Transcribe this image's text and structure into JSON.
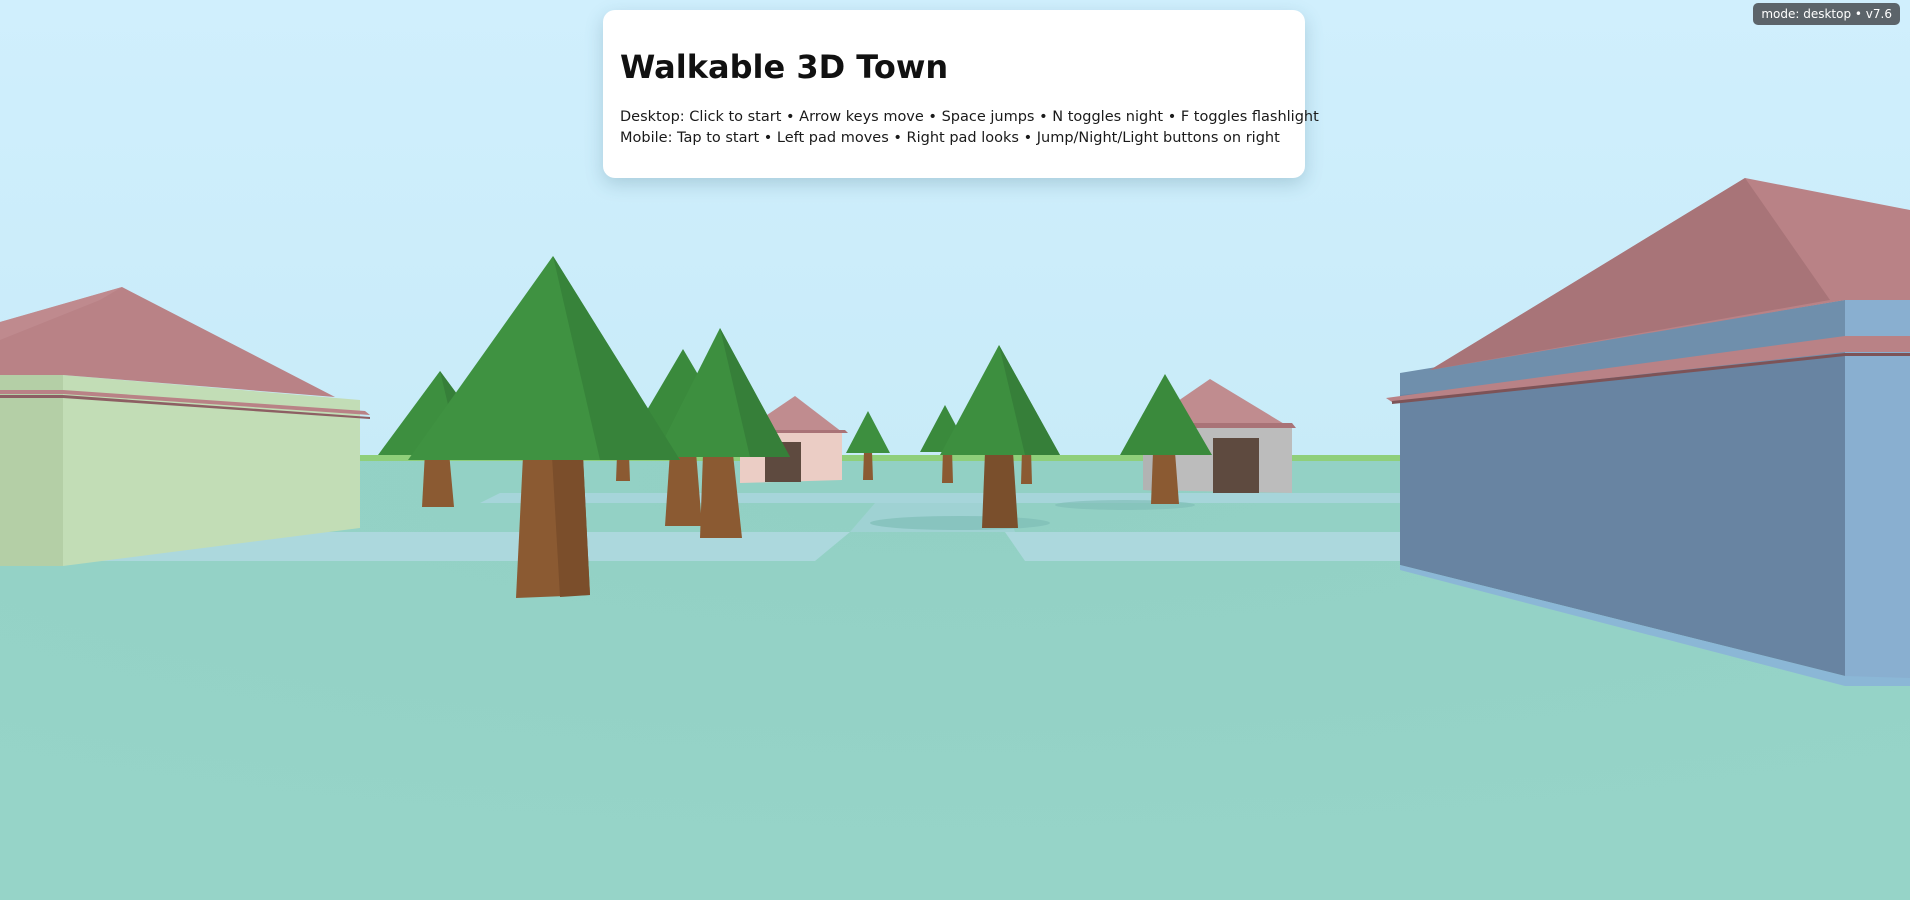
{
  "app": {
    "title": "Walkable 3D Town",
    "instructions": {
      "desktop": "Desktop: Click to start • Arrow keys move • Space jumps • N toggles night • F toggles flashlight",
      "mobile": "Mobile: Tap to start • Left pad moves • Right pad looks • Jump/Night/Light buttons on right"
    },
    "mode_badge": "mode: desktop • v7.6"
  },
  "scene": {
    "sky_color": "#cdeefc",
    "ground_color": "#96d4c7",
    "road_color": "#acd8dd",
    "grass_strip_color": "#8fcf7a",
    "foliage_color": "#3d8f3f",
    "trunk_color": "#8b5a32",
    "roof_color": "#b98286",
    "door_color": "#5e4a3f",
    "buildings": [
      {
        "name": "green-building-left",
        "wall": "#c2ddb6"
      },
      {
        "name": "pink-house-center",
        "wall": "#ebcdc5"
      },
      {
        "name": "gray-house-right",
        "wall": "#bcbcbc"
      },
      {
        "name": "blue-building-right",
        "wall": "#6884a2"
      }
    ]
  }
}
